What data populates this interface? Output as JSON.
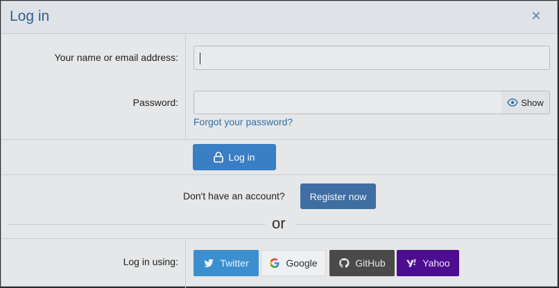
{
  "dialog": {
    "title": "Log in"
  },
  "form": {
    "username_label": "Your name or email address:",
    "password_label": "Password:",
    "show_label": "Show",
    "forgot_link": "Forgot your password?",
    "submit_label": "Log in"
  },
  "register": {
    "prompt": "Don't have an account?",
    "button_label": "Register now"
  },
  "separator": {
    "text": "or"
  },
  "social": {
    "label": "Log in using:",
    "providers": [
      {
        "label": "Twitter",
        "icon": "twitter-icon",
        "color": "#3b8fcf"
      },
      {
        "label": "Google",
        "icon": "google-icon",
        "color": "#eef0f2"
      },
      {
        "label": "GitHub",
        "icon": "github-icon",
        "color": "#4a4a4a"
      },
      {
        "label": "Yahoo",
        "icon": "yahoo-icon",
        "color": "#4d0d91"
      }
    ]
  },
  "colors": {
    "accent": "#3a7ec3",
    "register": "#3f6ea3",
    "title": "#2f5f93"
  }
}
